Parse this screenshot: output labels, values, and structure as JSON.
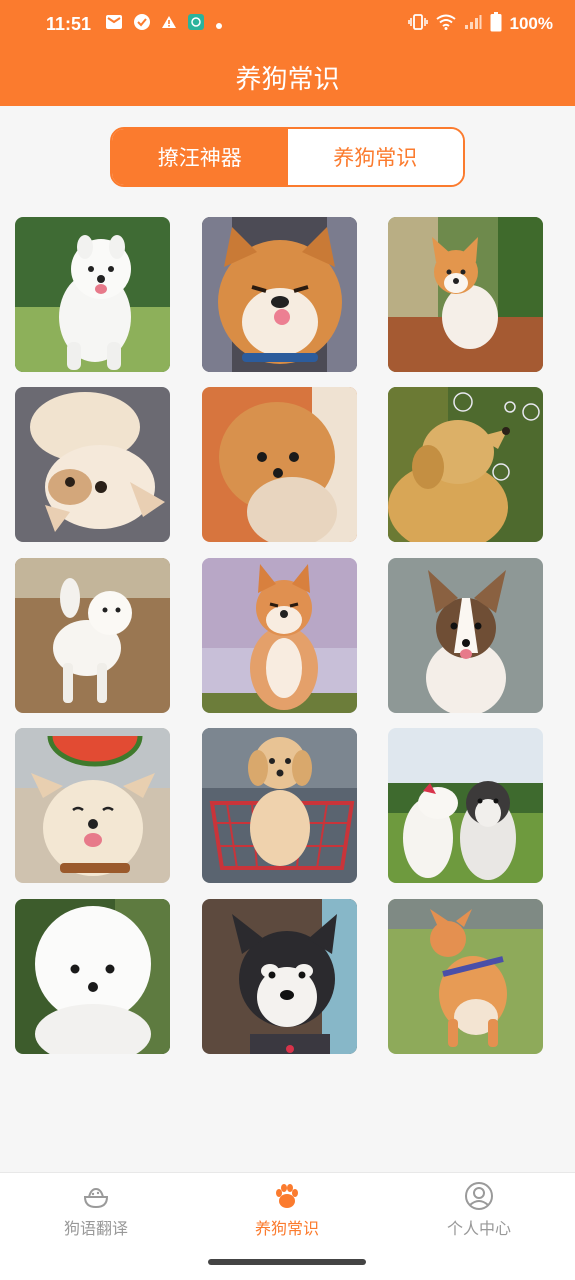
{
  "status_bar": {
    "time": "11:51",
    "battery": "100%",
    "icons": [
      "mail-icon",
      "check-circle-icon",
      "warning-icon",
      "app-icon",
      "dot-icon",
      "vibrate-icon",
      "wifi-icon",
      "signal-icon",
      "battery-icon"
    ]
  },
  "app_bar": {
    "title": "养狗常识"
  },
  "segment": {
    "items": [
      {
        "label": "撩汪神器",
        "active": true
      },
      {
        "label": "养狗常识",
        "active": false
      }
    ]
  },
  "gallery": {
    "items": [
      {
        "subject": "samoyed running on grass"
      },
      {
        "subject": "shiba inu sticking tongue out"
      },
      {
        "subject": "corgi puppy on wooden table"
      },
      {
        "subject": "french bulldog lying upside down"
      },
      {
        "subject": "pomeranian"
      },
      {
        "subject": "golden retriever with bubbles"
      },
      {
        "subject": "samoyed puppy on dirt ground"
      },
      {
        "subject": "shiba inu under cherry blossoms"
      },
      {
        "subject": "corgi puppy on pavement"
      },
      {
        "subject": "dog with watermelon on head"
      },
      {
        "subject": "golden puppy in shopping cart"
      },
      {
        "subject": "two dogs nuzzling"
      },
      {
        "subject": "bichon frise"
      },
      {
        "subject": "husky puppy"
      },
      {
        "subject": "corgi running on grass"
      }
    ]
  },
  "tab_bar": {
    "items": [
      {
        "label": "狗语翻译",
        "icon": "bowl-icon",
        "active": false
      },
      {
        "label": "养狗常识",
        "icon": "paw-icon",
        "active": true
      },
      {
        "label": "个人中心",
        "icon": "user-icon",
        "active": false
      }
    ]
  },
  "colors": {
    "accent": "#fb7b2e",
    "background": "#f6f6f6",
    "tab_inactive": "#999999"
  }
}
